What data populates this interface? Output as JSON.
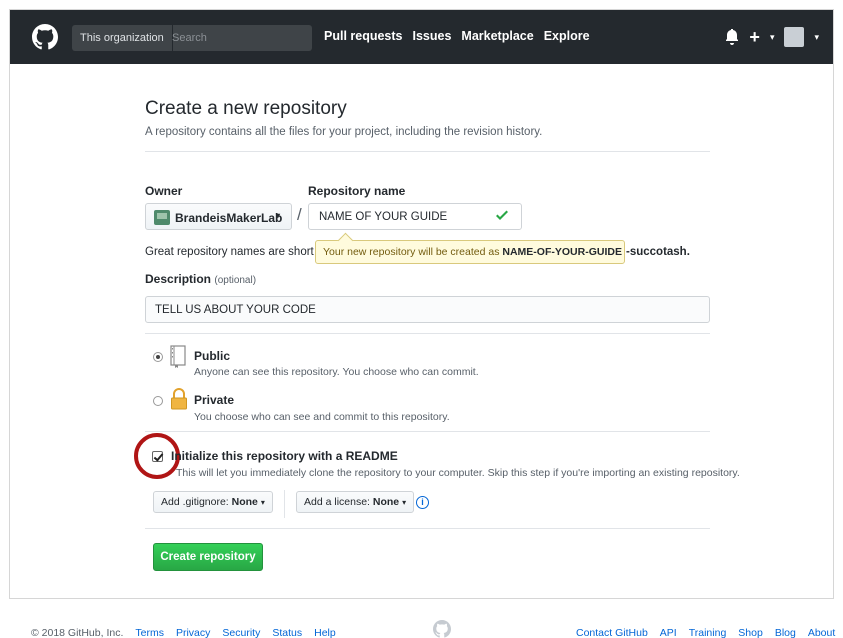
{
  "header": {
    "search_scope": "This organization",
    "search_placeholder": "Search",
    "nav": [
      "Pull requests",
      "Issues",
      "Marketplace",
      "Explore"
    ],
    "plus_label": "+",
    "caret": "▾"
  },
  "page": {
    "title": "Create a new repository",
    "subtitle": "A repository contains all the files for your project, including the revision history."
  },
  "form": {
    "owner_label": "Owner",
    "owner_value": "BrandeisMakerLab",
    "owner_caret": "▾",
    "slash": "/",
    "repo_name_label": "Repository name",
    "repo_name_value": "NAME OF YOUR GUIDE",
    "hint_text": "Great repository names are short",
    "hint_tail": "-succotash.",
    "tooltip_prefix": "Your new repository will be created as",
    "tooltip_name": "NAME-OF-YOUR-GUIDE",
    "description_label": "Description",
    "description_optional": "(optional)",
    "description_value": "TELL US ABOUT YOUR CODE",
    "public_title": "Public",
    "public_desc": "Anyone can see this repository. You choose who can commit.",
    "private_title": "Private",
    "private_desc": "You choose who can see and commit to this repository.",
    "visibility_selected": "public",
    "readme_title": "Initialize this repository with a README",
    "readme_desc": "This will let you immediately clone the repository to your computer. Skip this step if you're importing an existing repository.",
    "readme_checked": true,
    "gitignore_label": "Add .gitignore:",
    "gitignore_value": "None",
    "license_label": "Add a license:",
    "license_value": "None",
    "info_glyph": "i",
    "create_button": "Create repository"
  },
  "footer": {
    "copyright": "© 2018 GitHub, Inc.",
    "left_links": [
      "Terms",
      "Privacy",
      "Security",
      "Status",
      "Help"
    ],
    "right_links": [
      "Contact GitHub",
      "API",
      "Training",
      "Shop",
      "Blog",
      "About"
    ]
  },
  "colors": {
    "header_bg": "#24292e",
    "primary_green": "#28a745",
    "link_blue": "#0366d6",
    "annotation_red": "#b01515",
    "tooltip_bg": "#fffbdd"
  }
}
